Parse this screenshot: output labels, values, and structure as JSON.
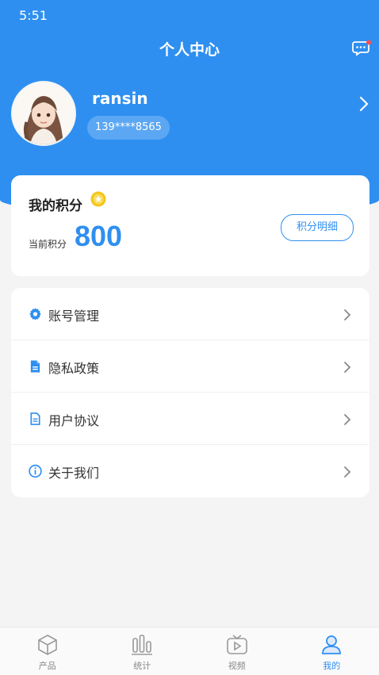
{
  "status_bar": {
    "time": "5:51"
  },
  "header": {
    "title": "个人中心",
    "message_icon": "chat-bubble-icon",
    "has_notification": true
  },
  "profile": {
    "username": "ransin",
    "phone": "139****8565",
    "avatar_icon": "girl-avatar"
  },
  "points": {
    "title": "我的积分",
    "badge_icon": "coin-icon",
    "current_label": "当前积分",
    "value": "800",
    "detail_button": "积分明细"
  },
  "menu": [
    {
      "label": "账号管理",
      "icon": "gear-icon"
    },
    {
      "label": "隐私政策",
      "icon": "document-icon"
    },
    {
      "label": "用户协议",
      "icon": "file-text-icon"
    },
    {
      "label": "关于我们",
      "icon": "info-icon"
    }
  ],
  "tabbar": [
    {
      "label": "产品",
      "icon": "cube-icon",
      "active": false
    },
    {
      "label": "统计",
      "icon": "bar-chart-icon",
      "active": false
    },
    {
      "label": "视频",
      "icon": "tv-play-icon",
      "active": false
    },
    {
      "label": "我的",
      "icon": "user-icon",
      "active": true
    }
  ],
  "colors": {
    "primary": "#2f8ff0",
    "background": "#f4f4f5",
    "coin": "#f5c518"
  }
}
